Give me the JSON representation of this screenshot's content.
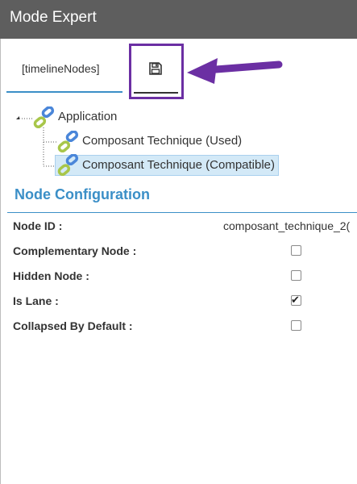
{
  "window": {
    "title": "Mode Expert"
  },
  "tabs": [
    {
      "label": "[timelineNodes]"
    },
    {
      "icon": "save-icon"
    }
  ],
  "annotation": {
    "color": "#6b2fa3",
    "icon": "arrow-left-icon"
  },
  "tree": {
    "root": {
      "label": "Application",
      "icon": "link-icon"
    },
    "children": [
      {
        "label": "Composant Technique (Used)",
        "icon": "link-icon"
      },
      {
        "label": "Composant Technique (Compatible)",
        "icon": "link-icon",
        "selected": true
      }
    ]
  },
  "config": {
    "title": "Node Configuration",
    "rows": [
      {
        "label": "Node ID :",
        "value": "composant_technique_2("
      },
      {
        "label": "Complementary Node :",
        "checked": false
      },
      {
        "label": "Hidden Node :",
        "checked": false
      },
      {
        "label": "Is Lane :",
        "checked": true
      },
      {
        "label": "Collapsed By Default :",
        "checked": false
      }
    ]
  },
  "colors": {
    "accent": "#3b8fc7",
    "titlebar": "#5e5e5e",
    "highlight": "#6b2fa3"
  }
}
